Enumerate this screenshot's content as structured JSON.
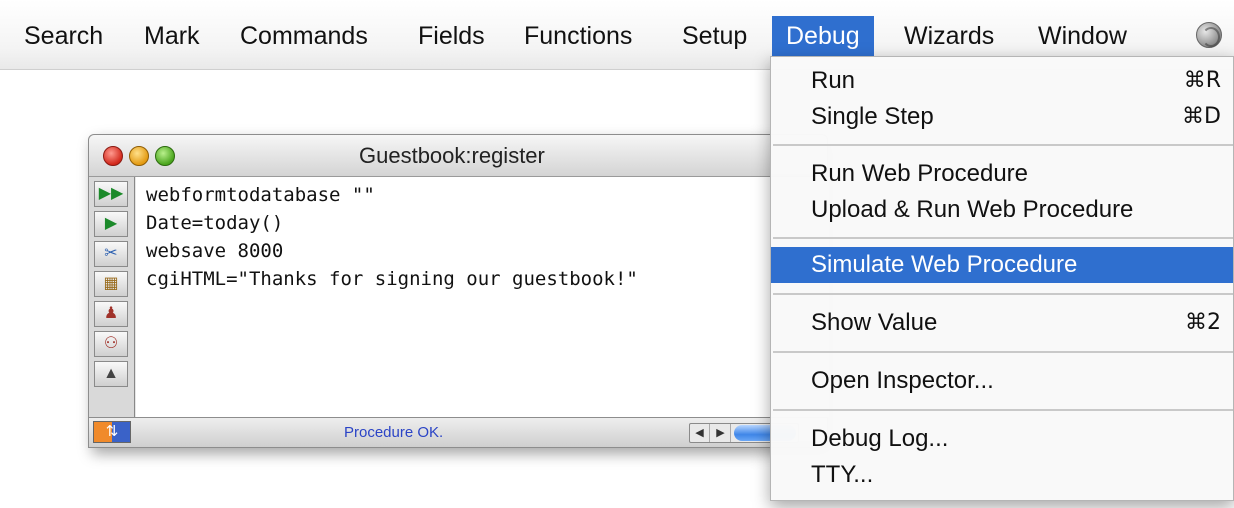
{
  "menubar": {
    "items": [
      "Search",
      "Mark",
      "Commands",
      "Fields",
      "Functions",
      "Setup",
      "Debug",
      "Wizards",
      "Window"
    ],
    "active": "Debug",
    "icon": "globe-icon"
  },
  "window": {
    "title": "Guestbook:register",
    "code": [
      "webformtodatabase \"\"",
      "Date=today()",
      "websave 8000",
      "cgiHTML=\"Thanks for signing our guestbook!\""
    ],
    "status": "Procedure OK."
  },
  "debug_menu": {
    "items": [
      {
        "label": "Run",
        "shortcut": "⌘R"
      },
      {
        "label": "Single Step",
        "shortcut": "⌘D"
      },
      {
        "label": "Run Web Procedure",
        "shortcut": ""
      },
      {
        "label": "Upload & Run Web Procedure",
        "shortcut": ""
      },
      {
        "label": "Simulate Web Procedure",
        "shortcut": ""
      },
      {
        "label": "Show Value",
        "shortcut": "⌘2"
      },
      {
        "label": "Open Inspector...",
        "shortcut": ""
      },
      {
        "label": "Debug Log...",
        "shortcut": ""
      },
      {
        "label": "TTY...",
        "shortcut": ""
      }
    ],
    "highlighted": "Simulate Web Procedure"
  },
  "colors": {
    "highlight": "#2f6fcf",
    "status_text": "#2b44c6"
  }
}
